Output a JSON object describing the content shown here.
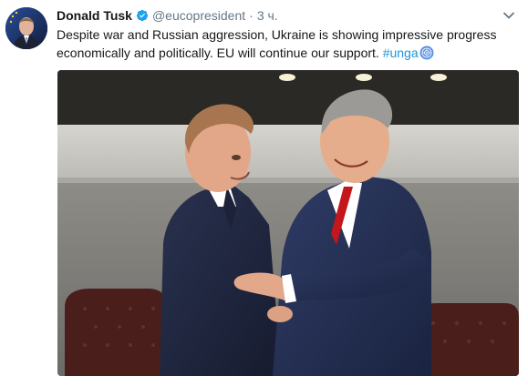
{
  "tweet": {
    "author_name": "Donald Tusk",
    "handle": "@eucopresident",
    "separator": "·",
    "time": "3 ч.",
    "text_main": "Despite war and Russian aggression, Ukraine is showing impressive progress economically and politically. EU will continue our support. ",
    "hashtag": "#unga"
  },
  "icons": {
    "verified": "verified-badge-icon",
    "caret": "chevron-down-icon",
    "un_emoji": "united-nations-emoji-icon"
  },
  "colors": {
    "accent": "#1b95e0",
    "muted": "#657786",
    "text": "#14171a"
  }
}
